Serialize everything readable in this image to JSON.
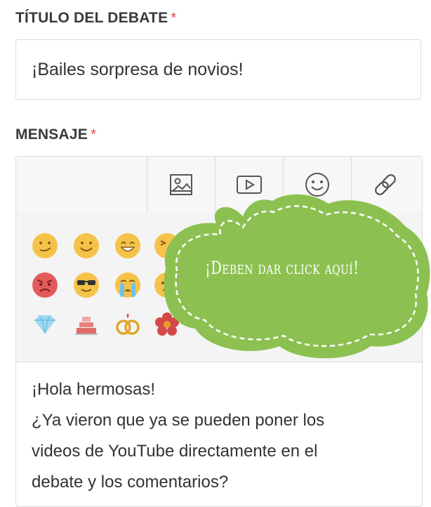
{
  "form": {
    "title_label": "TÍTULO DEL DEBATE",
    "message_label": "MENSAJE",
    "required_mark": "*",
    "title_value": "¡Bailes sorpresa de novios!"
  },
  "toolbar": {
    "buttons": [
      "image-icon",
      "video-icon",
      "emoji-icon",
      "link-icon"
    ]
  },
  "emojis": {
    "row1": [
      "smirk",
      "smile",
      "grin",
      "laughing"
    ],
    "row2": [
      "angry",
      "cool",
      "crying",
      "worried"
    ],
    "row3": [
      "diamond",
      "wedding-cake",
      "rings",
      "flower"
    ]
  },
  "message": {
    "lines": [
      "¡Hola hermosas!",
      "¿Ya vieron que ya se pueden poner los",
      "videos de YouTube  directamente en el",
      "debate y los comentarios?"
    ]
  },
  "callout": {
    "text": "¡Deben dar click aquí!",
    "color": "#8cc152"
  }
}
